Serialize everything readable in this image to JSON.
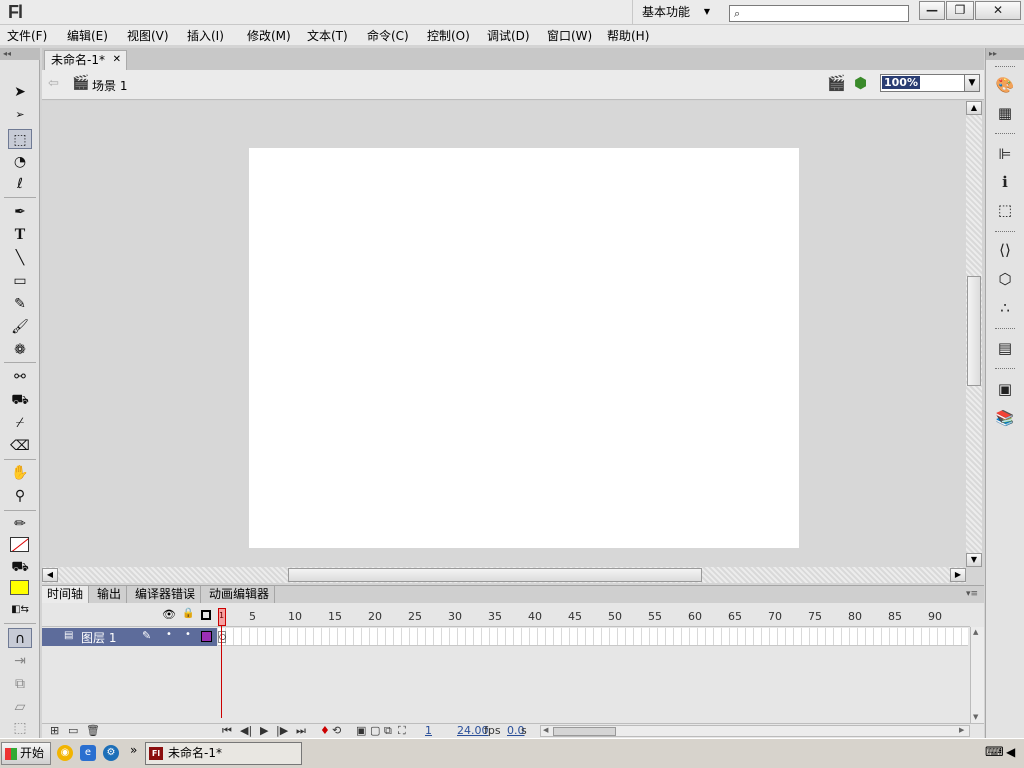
{
  "app": {
    "logo": "Fl",
    "workspace": "基本功能"
  },
  "window_controls": {
    "minimize": "—",
    "restore": "❐",
    "close": "✕"
  },
  "menu": [
    "文件(F)",
    "编辑(E)",
    "视图(V)",
    "插入(I)",
    "修改(M)",
    "文本(T)",
    "命令(C)",
    "控制(O)",
    "调试(D)",
    "窗口(W)",
    "帮助(H)"
  ],
  "document": {
    "tab_title": "未命名-1*",
    "scene": "场景 1",
    "zoom": "100%"
  },
  "timeline_tabs": [
    "时间轴",
    "输出",
    "编译器错误",
    "动画编辑器"
  ],
  "timeline": {
    "frame_numbers": [
      "1",
      "5",
      "10",
      "15",
      "20",
      "25",
      "30",
      "35",
      "40",
      "45",
      "50",
      "55",
      "60",
      "65",
      "70",
      "75",
      "80",
      "85",
      "90"
    ],
    "layer_name": "图层 1",
    "current_frame": "1",
    "fps": "24.00",
    "fps_unit": "fps",
    "elapsed": "0.0",
    "elapsed_unit": "s"
  },
  "colors": {
    "layer_highlight": "#5d6c9b",
    "layer_outline": "#9b2fb5",
    "fill_color": "#ffff00",
    "playhead": "#cc0000"
  },
  "taskbar": {
    "start_label": "开始",
    "task_title": "未命名-1*"
  }
}
